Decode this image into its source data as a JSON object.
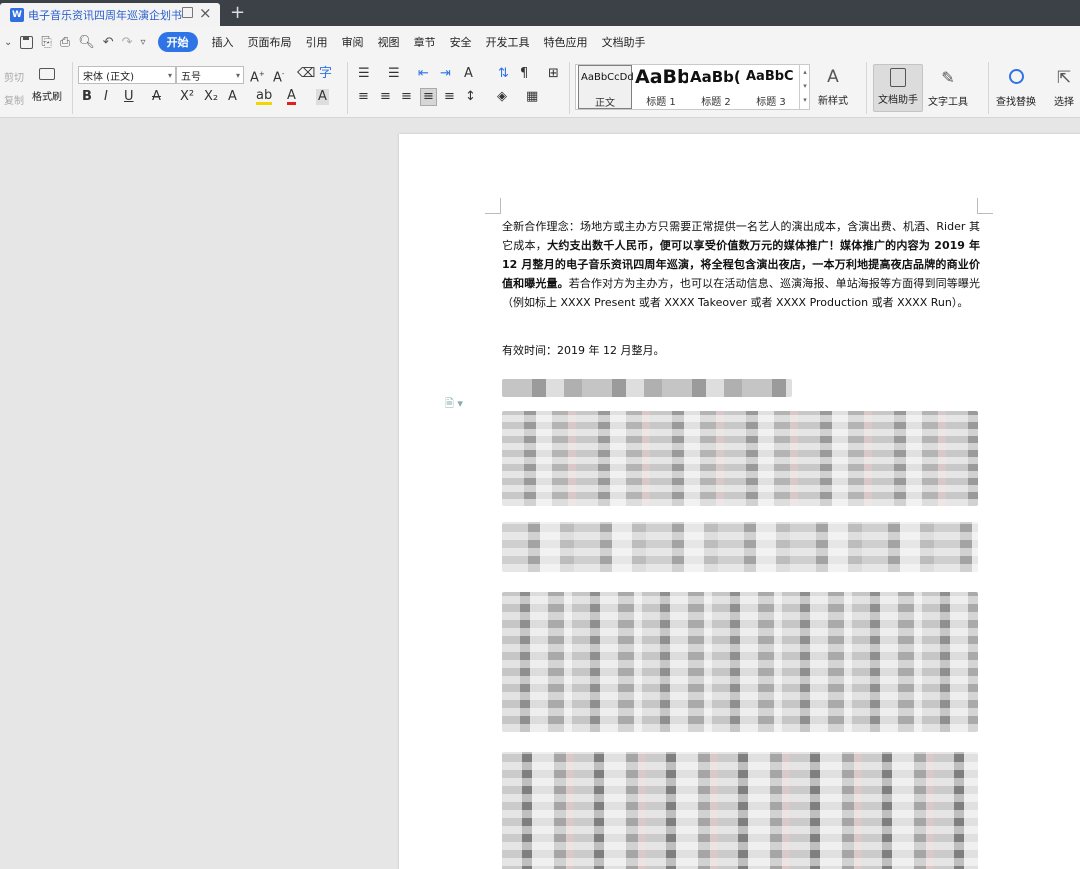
{
  "tab": {
    "app_letter": "W",
    "title": "电子音乐资讯四周年巡演企划书",
    "new_tab": "+"
  },
  "menu": {
    "tabs": [
      "开始",
      "插入",
      "页面布局",
      "引用",
      "审阅",
      "视图",
      "章节",
      "安全",
      "开发工具",
      "特色应用",
      "文档助手"
    ],
    "active": "开始"
  },
  "ribbon": {
    "cut": "剪切",
    "copy": "复制",
    "format_painter": "格式刷",
    "font_name": "宋体 (正文)",
    "font_size": "五号",
    "styles": [
      {
        "sample": "AaBbCcDd",
        "name": "正文"
      },
      {
        "sample": "AaBb",
        "name": "标题 1"
      },
      {
        "sample": "AaBb(",
        "name": "标题 2"
      },
      {
        "sample": "AaBbC",
        "name": "标题 3"
      }
    ],
    "new_style": "新样式",
    "doc_assistant": "文档助手",
    "text_tools": "文字工具",
    "find_replace": "查找替换",
    "select": "选择"
  },
  "document": {
    "para1_normal_a": "全新合作理念：场地方或主办方只需要正常提供一名艺人的演出成本，含演出费、机酒、Rider 其它成本，",
    "para1_bold": "大约支出数千人民币，便可以享受价值数万元的媒体推广！媒体推广的内容为 2019 年 12 月整月的电子音乐资讯四周年巡演，将全程包含演出夜店，一本万利地提高夜店品牌的商业价值和曝光量。",
    "para1_normal_b": "若合作对方为主办方，也可以在活动信息、巡演海报、单站海报等方面得到同等曝光（例如标上 XXXX Present 或者 XXXX Takeover 或者 XXXX Production 或者 XXXX Run）。",
    "valid_time": "有效时间：2019 年 12 月整月。"
  },
  "colors": {
    "titlebar": "#3c4047",
    "accent": "#2e74e6",
    "ribbon": "#f4f4f4",
    "canvas": "#e6e6e6"
  }
}
